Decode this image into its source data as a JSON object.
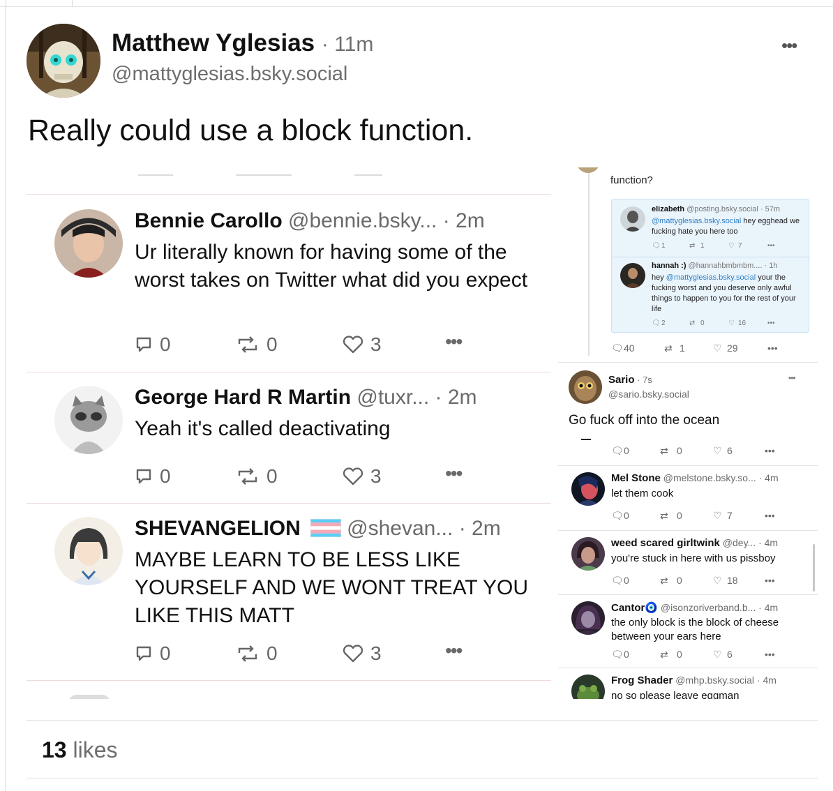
{
  "post": {
    "author_name": "Matthew Yglesias",
    "time": "· 11m",
    "handle": "@mattyglesias.bsky.social",
    "more": "•••",
    "text": "Really could use a block function.",
    "likes_count": "13",
    "likes_label": " likes"
  },
  "left_screenshot": {
    "replies": [
      {
        "name": "Bennie Carollo",
        "meta": " @bennie.bsky... · 2m",
        "text": "Ur literally known for having some of the worst takes on Twitter what did you expect",
        "comments": "0",
        "reposts": "0",
        "likes": "3"
      },
      {
        "name": "George Hard R Martin",
        "meta": " @tuxr... · 2m",
        "text": "Yeah it's called deactivating",
        "comments": "0",
        "reposts": "0",
        "likes": "3"
      },
      {
        "name": "SHEVANGELION",
        "meta": "@shevan... · 2m",
        "text": "MAYBE LEARN TO BE LESS LIKE YOURSELF AND WE WONT TREAT YOU LIKE THIS MATT",
        "comments": "0",
        "reposts": "0",
        "likes": "3"
      }
    ],
    "more": "•••"
  },
  "right_screenshot": {
    "top_text": "function?",
    "quoted": [
      {
        "name": "elizabeth",
        "meta": " @posting.bsky.social · 57m",
        "mention": "@mattyglesias.bsky.social",
        "text_after_mention": " hey egghead we fucking hate you here too",
        "comments": "1",
        "reposts": "1",
        "likes": "7"
      },
      {
        "name": "hannah :)",
        "meta": " @hannahbmbmbm.... · 1h",
        "text_before_mention": "hey ",
        "mention": "@mattyglesias.bsky.social",
        "text_after_mention": " your the fucking worst and you deserve only awful things to happen to you for the rest of your life",
        "comments": "2",
        "reposts": "0",
        "likes": "16"
      }
    ],
    "quote_post_actions": {
      "comments": "40",
      "reposts": "1",
      "likes": "29"
    },
    "sario": {
      "name": "Sario",
      "meta": " · 7s",
      "handle": "@sario.bsky.social",
      "text": "Go fuck off into the ocean",
      "comments": "0",
      "reposts": "0",
      "likes": "6"
    },
    "replies": [
      {
        "name": "Mel Stone",
        "meta": " @melstone.bsky.so... · 4m",
        "text": "let them cook",
        "comments": "0",
        "reposts": "0",
        "likes": "7"
      },
      {
        "name": "weed scared girltwink",
        "meta": " @dey... · 4m",
        "text": "you're stuck in here with us pissboy",
        "comments": "0",
        "reposts": "0",
        "likes": "18"
      },
      {
        "name": "Cantor🧿",
        "meta": " @isonzoriverband.b... · 4m",
        "text": "the only block is the block of cheese between your ears here",
        "comments": "0",
        "reposts": "0",
        "likes": "6"
      },
      {
        "name": "Frog Shader",
        "meta": " @mhp.bsky.social · 4m",
        "text": "no so please leave eggman"
      }
    ],
    "more": "•••"
  },
  "icons": [
    "comment-icon",
    "repost-icon",
    "heart-icon",
    "more-icon"
  ]
}
